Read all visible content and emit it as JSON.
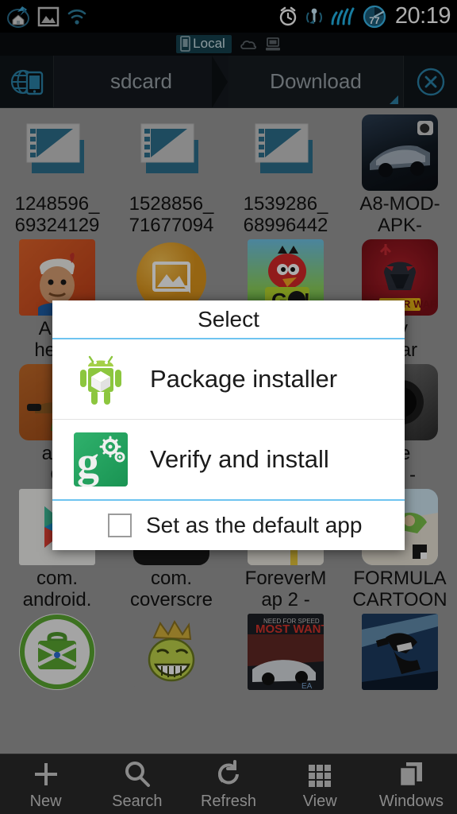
{
  "statusbar": {
    "time": "20:19",
    "left_icons": [
      "app-launcher-icon",
      "gallery-icon",
      "wifi-icon"
    ],
    "right_icons": [
      "alarm-clock-icon",
      "gps-location-icon",
      "signal-bars-icon"
    ],
    "battery_percent": "77"
  },
  "tabstrip": {
    "local_label": "Local",
    "icons": [
      "phone-icon",
      "cloud-icon",
      "computer-icon"
    ]
  },
  "breadcrumb": {
    "home_icon": "globe-device-icon",
    "segments": [
      "sdcard",
      "Download"
    ],
    "close_icon": "close-circle-icon"
  },
  "grid": {
    "rows": [
      [
        {
          "name": "file-video-1",
          "caption": [
            "1248596_",
            "69324129"
          ],
          "thumb": "video-file-icon"
        },
        {
          "name": "file-video-2",
          "caption": [
            "1528856_",
            "71677094"
          ],
          "thumb": "video-file-icon"
        },
        {
          "name": "file-video-3",
          "caption": [
            "1539286_",
            "68996442"
          ],
          "thumb": "video-file-icon"
        },
        {
          "name": "file-asphalt",
          "caption": [
            "A8-MOD-",
            "APK-"
          ],
          "thumb": "asphalt-game-icon"
        }
      ],
      [
        {
          "name": "file-akinator",
          "caption": [
            "Akin",
            "he_C"
          ],
          "thumb": "akinator-icon"
        },
        {
          "name": "file-image",
          "caption": [
            "",
            ""
          ],
          "thumb": "image-placeholder-icon"
        },
        {
          "name": "file-angrybirds",
          "caption": [
            "",
            ""
          ],
          "thumb": "angry-birds-go-icon"
        },
        {
          "name": "file-starwars",
          "caption": [
            "ry",
            "Star"
          ],
          "thumb": "star-wars-icon"
        }
      ],
      [
        {
          "name": "file-apk-brown",
          "caption": [
            "apk",
            "C"
          ],
          "thumb": "apk-brown-icon"
        },
        {
          "name": "file-hidden-1",
          "caption": [
            "",
            ""
          ],
          "thumb": "blank-icon"
        },
        {
          "name": "file-hidden-2",
          "caption": [
            "",
            ""
          ],
          "thumb": "blank-icon"
        },
        {
          "name": "file-dark-lens",
          "caption": [
            "ne",
            "elf -"
          ],
          "thumb": "dark-lens-icon"
        }
      ],
      [
        {
          "name": "file-play-store",
          "caption": [
            "com.",
            "android."
          ],
          "thumb": "play-store-icon"
        },
        {
          "name": "file-coverscreen",
          "caption": [
            "com.",
            "coverscre"
          ],
          "thumb": "coverscreen-icon"
        },
        {
          "name": "file-forevermap",
          "caption": [
            "ForeverM",
            "ap 2 -"
          ],
          "thumb": "forevermap-icon"
        },
        {
          "name": "file-formula",
          "caption": [
            "FORMULA",
            "CARTOON"
          ],
          "thumb": "formula-cartoon-icon"
        }
      ],
      [
        {
          "name": "file-green-circle",
          "caption": [
            "",
            ""
          ],
          "thumb": "green-bag-icon"
        },
        {
          "name": "file-troll",
          "caption": [
            "",
            ""
          ],
          "thumb": "troll-king-icon"
        },
        {
          "name": "file-nfs",
          "caption": [
            "",
            ""
          ],
          "thumb": "need-for-speed-icon"
        },
        {
          "name": "file-runner",
          "caption": [
            "",
            ""
          ],
          "thumb": "runner-icon"
        }
      ]
    ]
  },
  "bottomnav": {
    "items": [
      {
        "label": "New",
        "icon": "plus-icon"
      },
      {
        "label": "Search",
        "icon": "search-icon"
      },
      {
        "label": "Refresh",
        "icon": "refresh-icon"
      },
      {
        "label": "View",
        "icon": "grid-view-icon"
      },
      {
        "label": "Windows",
        "icon": "windows-stack-icon"
      }
    ]
  },
  "dialog": {
    "title": "Select",
    "options": [
      {
        "label": "Package installer",
        "icon": "android-package-installer-icon"
      },
      {
        "label": "Verify and install",
        "icon": "google-play-verify-icon"
      }
    ],
    "default_checkbox_label": "Set as the default app",
    "default_checkbox_checked": false
  },
  "colors": {
    "accent_blue": "#6ec4f0",
    "tab_active_bg": "#15414f",
    "status_bar_bg": "#000000",
    "grid_bg": "#9a9a9a",
    "dialog_bg": "#ffffff"
  }
}
